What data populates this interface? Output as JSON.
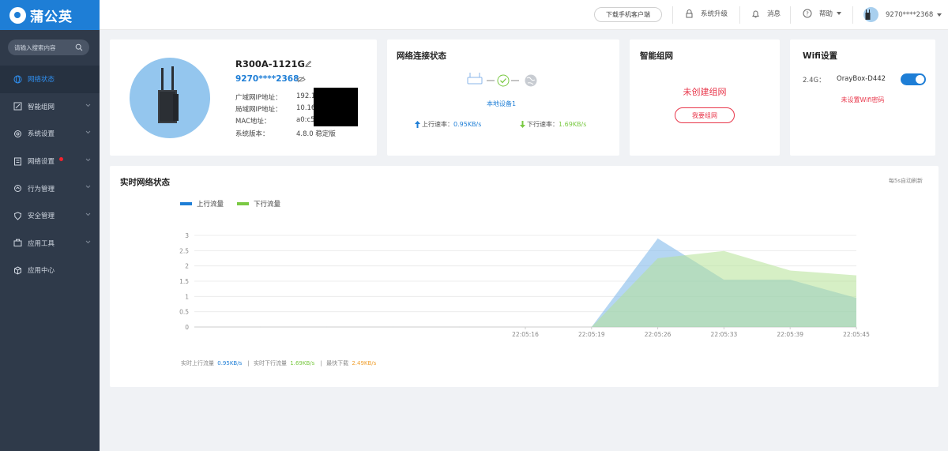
{
  "brand": {
    "name": "蒲公英"
  },
  "sidebar": {
    "search_placeholder": "请输入搜索内容",
    "items": [
      {
        "label": "网络状态",
        "active": true,
        "icon": "globe-icon"
      },
      {
        "label": "智能组网",
        "icon": "network-icon",
        "caret": true
      },
      {
        "label": "系统设置",
        "icon": "gear-icon",
        "caret": true
      },
      {
        "label": "网络设置",
        "icon": "document-icon",
        "caret": true,
        "badge": true
      },
      {
        "label": "行为管理",
        "icon": "behavior-icon",
        "caret": true
      },
      {
        "label": "安全管理",
        "icon": "shield-icon",
        "caret": true
      },
      {
        "label": "应用工具",
        "icon": "toolbox-icon",
        "caret": true
      },
      {
        "label": "应用中心",
        "icon": "cube-icon"
      }
    ]
  },
  "topbar": {
    "download": "下载手机客户端",
    "upgrade": "系统升级",
    "messages": "消息",
    "help": "帮助",
    "user": "9270****2368"
  },
  "device": {
    "name": "R300A-1121G",
    "id": "9270****2368",
    "fields": [
      {
        "label": "广域网IP地址：",
        "value": "192.1"
      },
      {
        "label": "局域网IP地址：",
        "value": "10.16"
      },
      {
        "label": "MAC地址：",
        "value": "a0:c5"
      },
      {
        "label": "系统版本：",
        "value": "4.8.0 稳定版"
      }
    ]
  },
  "connection": {
    "title": "网络连接状态",
    "local_device": "本地设备1",
    "up_label": "上行速率：",
    "up_value": "0.95KB/s",
    "down_label": "下行速率：",
    "down_value": "1.69KB/s"
  },
  "smartnet": {
    "title": "智能组网",
    "status": "未创建组网",
    "button": "我要组网"
  },
  "wifi": {
    "title": "Wifi设置",
    "band": "2.4G：",
    "ssid": "OrayBox-D442",
    "warning": "未设置Wifi密码",
    "enabled": true
  },
  "realtime": {
    "title": "实时网络状态",
    "refresh_note": "每5s自动刷新",
    "stats": {
      "up_label": "实时上行流量",
      "up_value": "0.95KB/s",
      "down_label": "实时下行流量",
      "down_value": "1.69KB/s",
      "max_label": "最快下载",
      "max_value": "2.49KB/s"
    }
  },
  "colors": {
    "accent": "#1e7ed6",
    "upload": "#1e7ed6",
    "download": "#7ac943",
    "max": "#f0a030",
    "alert": "#e8364a"
  },
  "chart_data": {
    "type": "area",
    "x": [
      "",
      "",
      "",
      "",
      "",
      "22:05:16",
      "22:05:19",
      "22:05:26",
      "22:05:33",
      "22:05:39",
      "22:05:45"
    ],
    "x_pos": [
      0,
      0.1,
      0.2,
      0.3,
      0.4,
      0.5,
      0.6,
      0.7,
      0.8,
      0.9,
      1
    ],
    "y_ticks": [
      "0",
      "0.5",
      "1",
      "1.5",
      "2",
      "2.5",
      "3"
    ],
    "ylim": [
      0,
      3
    ],
    "grid": true,
    "legend_position": "top-left",
    "series": [
      {
        "name": "上行流量",
        "color": "#78b4ea",
        "values": [
          0,
          0,
          0,
          0,
          0,
          0,
          0,
          2.9,
          1.55,
          1.55,
          0.95
        ]
      },
      {
        "name": "下行流量",
        "color": "#b4e196",
        "values": [
          0,
          0,
          0,
          0,
          0,
          0,
          0,
          2.25,
          2.49,
          1.85,
          1.69
        ]
      }
    ]
  }
}
